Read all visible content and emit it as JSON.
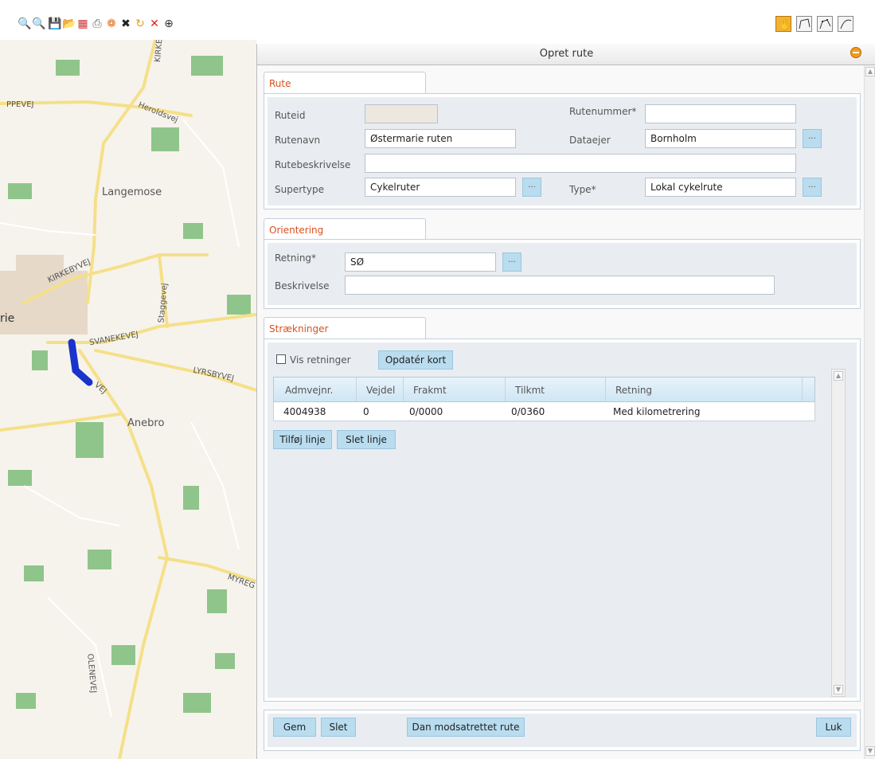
{
  "toolbar": {
    "left_icons": [
      "zoom-out-icon",
      "zoom-in-icon",
      "save-icon",
      "open-folder-icon",
      "table-icon",
      "print-icon",
      "layers-icon",
      "remove-layer-icon",
      "refresh-icon",
      "delete-icon",
      "crosshair-icon"
    ],
    "right_tools": [
      "pan-hand-icon",
      "draw-line-icon",
      "edit-line-icon",
      "draw-arc-icon"
    ]
  },
  "map": {
    "labels": [
      "PPEVEJ",
      "Heroldsvej",
      "KIRKE",
      "Langemose",
      "KIRKEBYVEJ",
      "Staggevej",
      "rie",
      "SVANEKEVEJ",
      "LYRSBYVEJ",
      "VEJ",
      "Anebro",
      "MYREG",
      "OLENEVEJ"
    ],
    "route_color": "#1a33cc"
  },
  "dialog": {
    "title": "Opret rute",
    "rute": {
      "tab": "Rute",
      "ruteid_label": "Ruteid",
      "ruteid_value": "",
      "rutenummer_label": "Rutenummer*",
      "rutenummer_value": "",
      "rutenavn_label": "Rutenavn",
      "rutenavn_value": "Østermarie ruten",
      "dataejer_label": "Dataejer",
      "dataejer_value": "Bornholm",
      "rutebeskrivelse_label": "Rutebeskrivelse",
      "rutebeskrivelse_value": "",
      "supertype_label": "Supertype",
      "supertype_value": "Cykelruter",
      "type_label": "Type*",
      "type_value": "Lokal cykelrute",
      "dots": "..."
    },
    "orientering": {
      "tab": "Orientering",
      "retning_label": "Retning*",
      "retning_value": "SØ",
      "beskrivelse_label": "Beskrivelse",
      "beskrivelse_value": ""
    },
    "straekninger": {
      "tab": "Strækninger",
      "vis_retninger": "Vis retninger",
      "opdater_kort": "Opdatér kort",
      "columns": [
        "Admvejnr.",
        "Vejdel",
        "Frakmt",
        "Tilkmt",
        "Retning"
      ],
      "rows": [
        {
          "admvejnr": "4004938",
          "vejdel": "0",
          "frakmt": "0/0000",
          "tilkmt": "0/0360",
          "retning": "Med kilometrering"
        }
      ],
      "tilfoej_linje": "Tilføj linje",
      "slet_linje": "Slet linje"
    },
    "footer": {
      "gem": "Gem",
      "slet": "Slet",
      "dan_modsatrettet": "Dan modsatrettet rute",
      "luk": "Luk"
    }
  }
}
